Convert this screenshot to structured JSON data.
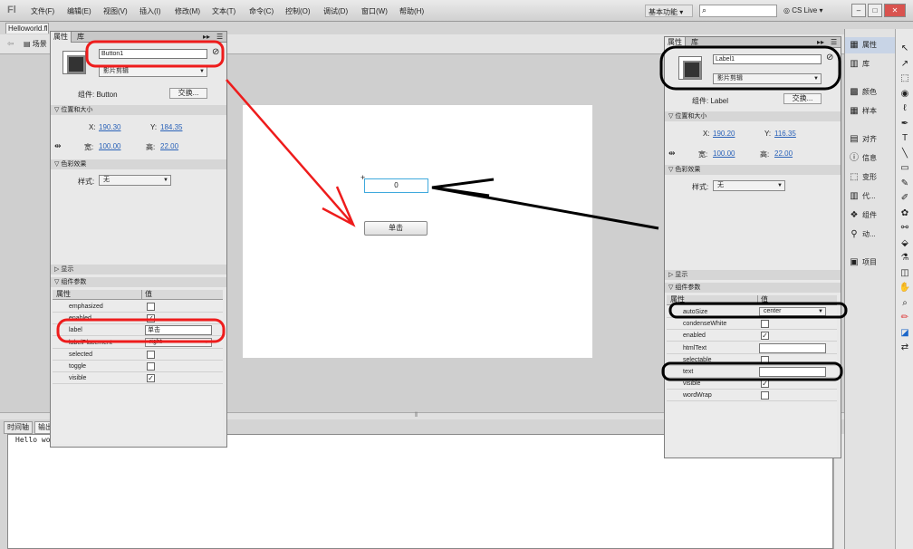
{
  "app": {
    "logo": "Fl",
    "workspace": "基本功能",
    "search_placeholder": "",
    "cslive": "CS Live",
    "win_min": "–",
    "win_max": "□",
    "win_close": "✕"
  },
  "menu": [
    "文件(F)",
    "编辑(E)",
    "视图(V)",
    "插入(I)",
    "修改(M)",
    "文本(T)",
    "命令(C)",
    "控制(O)",
    "调试(D)",
    "窗口(W)",
    "帮助(H)"
  ],
  "document": {
    "tab": "Helloworld.fla*",
    "scene": "场景"
  },
  "stage": {
    "button_label": "单击",
    "label_text": "0"
  },
  "left_panel": {
    "tabs": [
      "属性",
      "库"
    ],
    "instance_name": "Button1",
    "symbol_type": "影片剪辑",
    "component_label": "组件: Button",
    "swap_button": "交换...",
    "pos_section": "位置和大小",
    "x_label": "X:",
    "x_value": "190.30",
    "y_label": "Y:",
    "y_value": "184.35",
    "w_label": "宽:",
    "w_value": "100.00",
    "h_label": "高:",
    "h_value": "22.00",
    "color_section": "色彩效果",
    "style_label": "样式:",
    "style_value": "无",
    "display_section": "显示",
    "params_section": "组件参数",
    "col_prop": "属性",
    "col_val": "值",
    "params": [
      {
        "name": "emphasized",
        "type": "check",
        "checked": false
      },
      {
        "name": "enabled",
        "type": "check",
        "checked": true
      },
      {
        "name": "label",
        "type": "text",
        "value": "单击"
      },
      {
        "name": "labelPlacement",
        "type": "select",
        "value": "right"
      },
      {
        "name": "selected",
        "type": "check",
        "checked": false
      },
      {
        "name": "toggle",
        "type": "check",
        "checked": false
      },
      {
        "name": "visible",
        "type": "check",
        "checked": true
      }
    ]
  },
  "right_panel": {
    "tabs": [
      "属性",
      "库"
    ],
    "instance_name": "Label1",
    "symbol_type": "影片剪辑",
    "component_label": "组件: Label",
    "swap_button": "交换...",
    "pos_section": "位置和大小",
    "x_label": "X:",
    "x_value": "190.20",
    "y_label": "Y:",
    "y_value": "116.35",
    "w_label": "宽:",
    "w_value": "100.00",
    "h_label": "高:",
    "h_value": "22.00",
    "color_section": "色彩效果",
    "style_label": "样式:",
    "style_value": "无",
    "display_section": "显示",
    "params_section": "组件参数",
    "col_prop": "属性",
    "col_val": "值",
    "params": [
      {
        "name": "autoSize",
        "type": "select",
        "value": "center"
      },
      {
        "name": "condenseWhite",
        "type": "check",
        "checked": false
      },
      {
        "name": "enabled",
        "type": "check",
        "checked": true
      },
      {
        "name": "htmlText",
        "type": "text",
        "value": ""
      },
      {
        "name": "selectable",
        "type": "check",
        "checked": false
      },
      {
        "name": "text",
        "type": "text",
        "value": ""
      },
      {
        "name": "visible",
        "type": "check",
        "checked": true
      },
      {
        "name": "wordWrap",
        "type": "check",
        "checked": false
      }
    ]
  },
  "timeline": {
    "tab1": "时间轴",
    "tab2": "输出"
  },
  "output": {
    "text": "Hello wo"
  },
  "side_panels": [
    {
      "label": "属性",
      "icon": "properties-icon",
      "glyph": "▦",
      "active": true
    },
    {
      "label": "库",
      "icon": "library-icon",
      "glyph": "▥",
      "active": false
    },
    {
      "label": "颜色",
      "icon": "color-icon",
      "glyph": "▩",
      "active": false
    },
    {
      "label": "样本",
      "icon": "swatches-icon",
      "glyph": "▦",
      "active": false
    },
    {
      "label": "对齐",
      "icon": "align-icon",
      "glyph": "▤",
      "active": false
    },
    {
      "label": "信息",
      "icon": "info-icon",
      "glyph": "ⓘ",
      "active": false
    },
    {
      "label": "变形",
      "icon": "transform-icon",
      "glyph": "⬚",
      "active": false
    },
    {
      "label": "代...",
      "icon": "code-snippets-icon",
      "glyph": "▥",
      "active": false
    },
    {
      "label": "组件",
      "icon": "components-icon",
      "glyph": "❖",
      "active": false
    },
    {
      "label": "动...",
      "icon": "motion-presets-icon",
      "glyph": "⚲",
      "active": false
    },
    {
      "label": "项目",
      "icon": "project-icon",
      "glyph": "▣",
      "active": false
    }
  ],
  "tools": [
    {
      "icon": "selection-tool-icon",
      "glyph": "↖"
    },
    {
      "icon": "subselection-tool-icon",
      "glyph": "↗"
    },
    {
      "icon": "free-transform-tool-icon",
      "glyph": "⬚"
    },
    {
      "icon": "3d-rotation-tool-icon",
      "glyph": "◉"
    },
    {
      "icon": "lasso-tool-icon",
      "glyph": "ℓ"
    },
    {
      "icon": "pen-tool-icon",
      "glyph": "✒"
    },
    {
      "icon": "text-tool-icon",
      "glyph": "T"
    },
    {
      "icon": "line-tool-icon",
      "glyph": "╲"
    },
    {
      "icon": "rectangle-tool-icon",
      "glyph": "▭"
    },
    {
      "icon": "pencil-tool-icon",
      "glyph": "✎"
    },
    {
      "icon": "brush-tool-icon",
      "glyph": "✐"
    },
    {
      "icon": "deco-tool-icon",
      "glyph": "✿"
    },
    {
      "icon": "bone-tool-icon",
      "glyph": "⚯"
    },
    {
      "icon": "paint-bucket-tool-icon",
      "glyph": "⬙"
    },
    {
      "icon": "eyedropper-tool-icon",
      "glyph": "⚗"
    },
    {
      "icon": "eraser-tool-icon",
      "glyph": "◫"
    },
    {
      "icon": "hand-tool-icon",
      "glyph": "✋"
    },
    {
      "icon": "zoom-tool-icon",
      "glyph": "⌕"
    },
    {
      "icon": "stroke-color-icon",
      "glyph": "✏"
    },
    {
      "icon": "fill-color-icon",
      "glyph": "◪"
    },
    {
      "icon": "swap-colors-icon",
      "glyph": "⇄"
    }
  ],
  "colors": {
    "annotation_red": "#ee1c1c",
    "annotation_black": "#000000",
    "link_blue": "#2a62b8"
  }
}
